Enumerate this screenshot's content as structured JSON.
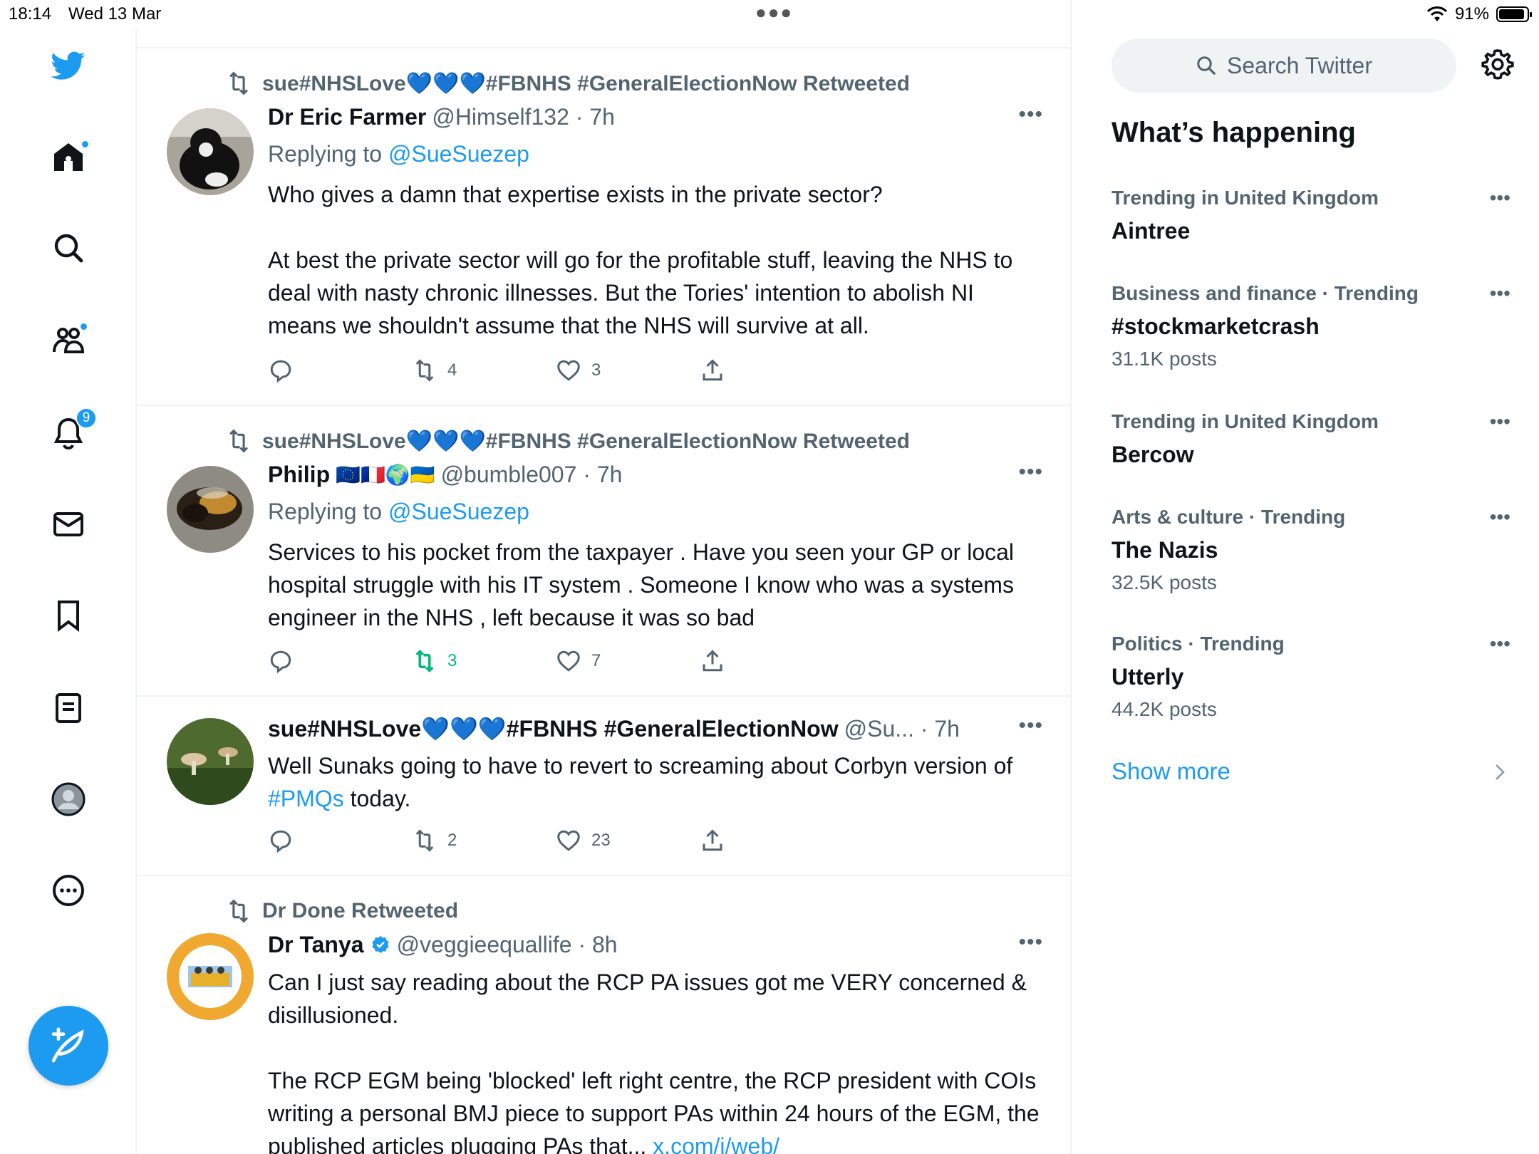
{
  "status_bar": {
    "time": "18:14",
    "date": "Wed 13 Mar",
    "battery": "91%",
    "battery_level": 0.91
  },
  "left_nav": {
    "notifications_badge": "9",
    "items": [
      "home-icon",
      "explore-icon",
      "communities-icon",
      "notifications-icon",
      "messages-icon",
      "bookmarks-icon",
      "lists-icon",
      "profile-icon",
      "more-icon"
    ]
  },
  "colors": {
    "accent": "#1d9bf0",
    "retweet_active": "#00ba7c",
    "secondary_text": "#536471"
  },
  "tweets": [
    {
      "retweeted_by": "sue#NHSLove💙💙💙#FBNHS #GeneralElectionNow Retweeted",
      "name": "Dr Eric Farmer",
      "handle_time": "@Himself132 · 7h",
      "replying_prefix": "Replying to ",
      "replying_to": "@SueSuezep",
      "body_p1": "Who gives a damn that expertise exists in the private sector?",
      "body_p2": "At best the private sector will go for the profitable stuff, leaving the NHS to deal with nasty chronic illnesses. But the Tories' intention to abolish NI means we shouldn't assume that the NHS will survive at all.",
      "retweets": "4",
      "likes": "3"
    },
    {
      "retweeted_by": "sue#NHSLove💙💙💙#FBNHS #GeneralElectionNow Retweeted",
      "name": "Philip",
      "name_flags": "🇪🇺🇫🇷🌍🇺🇦",
      "handle_time": "@bumble007 · 7h",
      "replying_prefix": "Replying to ",
      "replying_to": "@SueSuezep",
      "body": "Services to his pocket from the taxpayer . Have you seen your GP or local hospital struggle with his IT system . Someone I know who was a systems engineer in the NHS , left because it was so bad",
      "retweets": "3",
      "likes": "7"
    },
    {
      "name": "sue#NHSLove💙💙💙#FBNHS #GeneralElectionNow",
      "handle_time": "@Su... · 7h",
      "body_start": "Well Sunaks going to have to revert to screaming about Corbyn version of ",
      "body_link": "#PMQs",
      "body_end": " today.",
      "retweets": "2",
      "likes": "23"
    },
    {
      "retweeted_by": "Dr Done Retweeted",
      "name": "Dr Tanya",
      "handle_time": "@veggieequallife · 8h",
      "body_p1": "Can I just say reading about the RCP PA issues got me VERY concerned & disillusioned.",
      "body_p2": "The RCP EGM being 'blocked' left right centre, the RCP president with COIs writing a personal BMJ piece to support PAs within 24 hours of the EGM, the published articles plugging PAs that... ",
      "body_p2_link": "x.com/i/web/"
    }
  ],
  "sidebar": {
    "search_placeholder": "Search Twitter",
    "title": "What’s happening",
    "trends": [
      {
        "meta": "Trending in United Kingdom",
        "topic": "Aintree",
        "count": ""
      },
      {
        "meta": "Business and finance · Trending",
        "topic": "#stockmarketcrash",
        "count": "31.1K posts"
      },
      {
        "meta": "Trending in United Kingdom",
        "topic": "Bercow",
        "count": ""
      },
      {
        "meta": "Arts & culture · Trending",
        "topic": "The Nazis",
        "count": "32.5K posts"
      },
      {
        "meta": "Politics · Trending",
        "topic": "Utterly",
        "count": "44.2K posts"
      }
    ],
    "show_more": "Show more"
  }
}
